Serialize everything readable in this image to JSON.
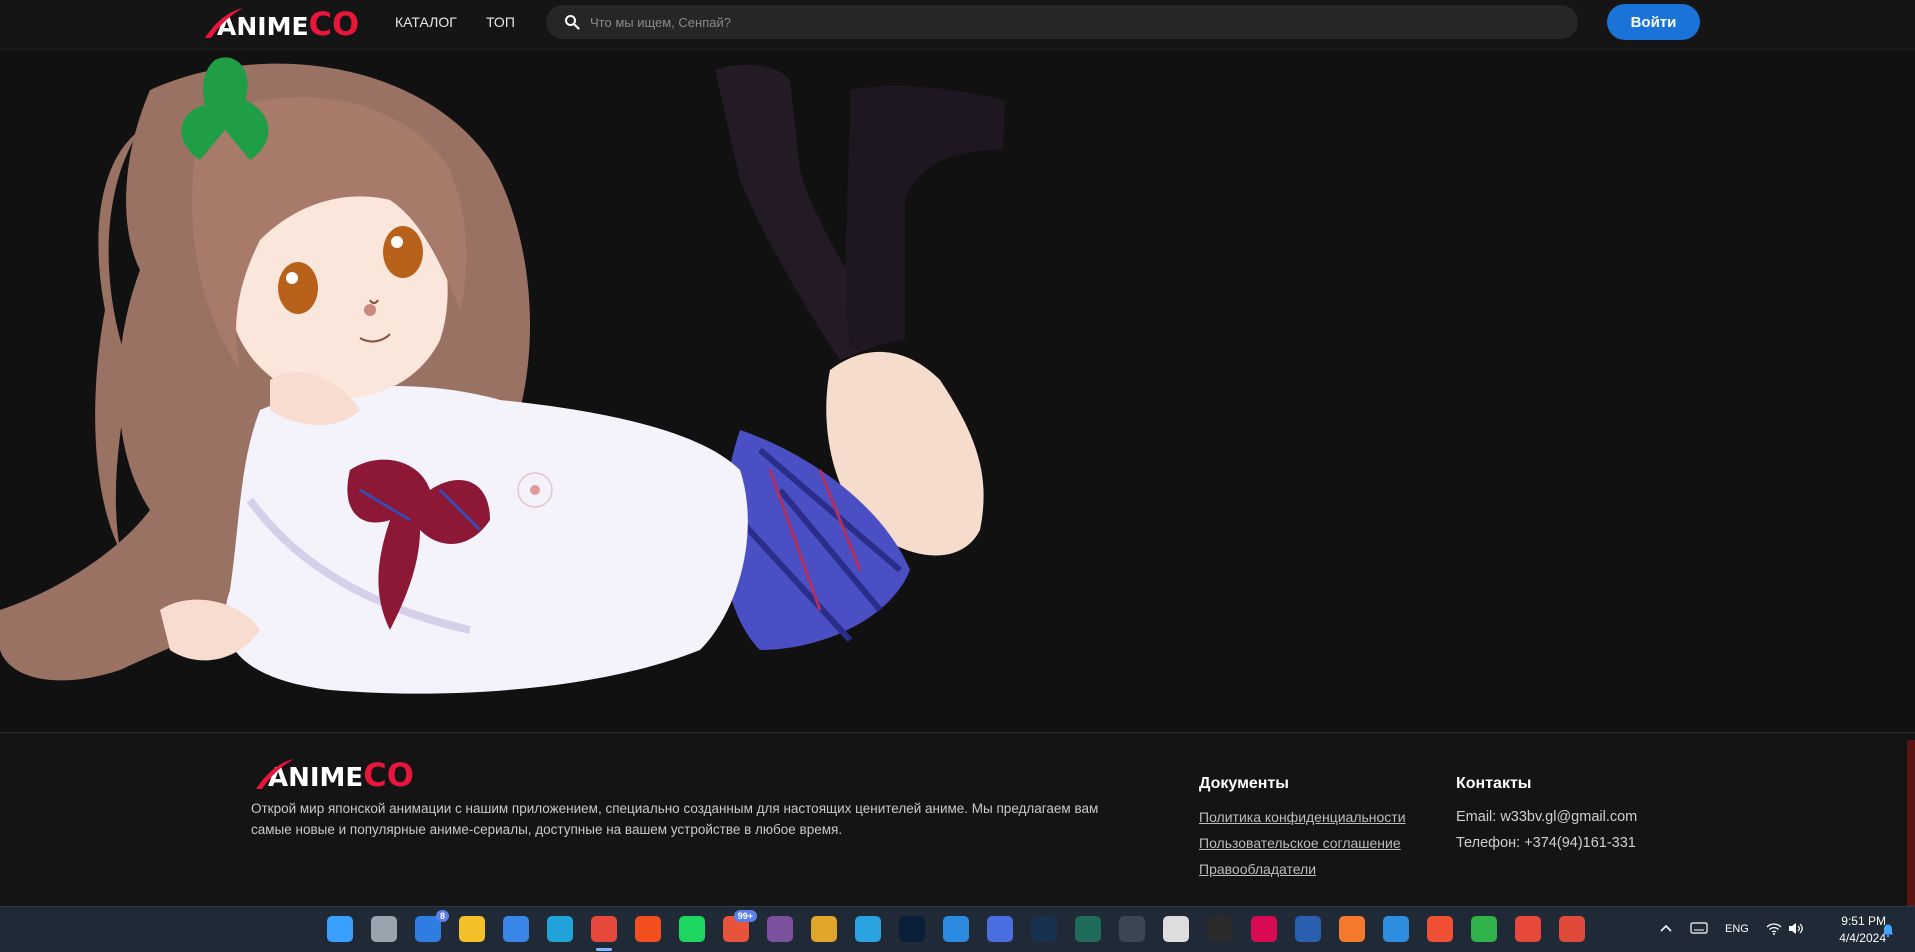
{
  "header": {
    "logo_main": "ANIME",
    "logo_accent": "CO",
    "nav": [
      {
        "label": "КАТАЛОГ"
      },
      {
        "label": "ТОП"
      }
    ],
    "search": {
      "placeholder": "Что мы ищем, Сенпай?"
    },
    "login_label": "Войти"
  },
  "footer": {
    "logo_main": "ANIME",
    "logo_accent": "CO",
    "description": "Открой мир японской анимации с нашим приложением, специально созданным для настоящих ценителей аниме. Мы предлагаем вам самые новые и популярные аниме-сериалы, доступные на вашем устройстве в любое время.",
    "documents": {
      "title": "Документы",
      "links": [
        "Политика конфиденциальности",
        "Пользовательское соглашение",
        "Правообладатели"
      ]
    },
    "contacts": {
      "title": "Контакты",
      "email": "Email: w33bv.gl@gmail.com",
      "phone": "Телефон: +374(94)161-331"
    }
  },
  "taskbar": {
    "apps": [
      {
        "name": "windows-start",
        "color": "#3aa0ff"
      },
      {
        "name": "task-view",
        "color": "#9aa4ae"
      },
      {
        "name": "widgets",
        "color": "#2f7de1",
        "badge": "8"
      },
      {
        "name": "file-explorer",
        "color": "#f3c02a"
      },
      {
        "name": "microsoft-store",
        "color": "#3a86e8"
      },
      {
        "name": "edge",
        "color": "#1fa3d8"
      },
      {
        "name": "chrome",
        "color": "#e6483b"
      },
      {
        "name": "figma",
        "color": "#f24e1e"
      },
      {
        "name": "spotify",
        "color": "#1ed760"
      },
      {
        "name": "mail",
        "color": "#e8533b",
        "badge": "99+"
      },
      {
        "name": "viber",
        "color": "#7b519d"
      },
      {
        "name": "lgbt-app",
        "color": "#e0a52a"
      },
      {
        "name": "telegram",
        "color": "#2aa3e0"
      },
      {
        "name": "photoshop",
        "color": "#0b1e3a"
      },
      {
        "name": "vscode",
        "color": "#2a8be0"
      },
      {
        "name": "app-a",
        "color": "#4a6ee0"
      },
      {
        "name": "steam",
        "color": "#17314f"
      },
      {
        "name": "terminal-green",
        "color": "#1e6b5a"
      },
      {
        "name": "calculator",
        "color": "#3a4652"
      },
      {
        "name": "unity",
        "color": "#ddd"
      },
      {
        "name": "terminal",
        "color": "#2b2b2b"
      },
      {
        "name": "debian",
        "color": "#d70a53"
      },
      {
        "name": "powershell",
        "color": "#2a5fb0"
      },
      {
        "name": "blender",
        "color": "#f5792a"
      },
      {
        "name": "remote-desktop",
        "color": "#2d8ee0"
      },
      {
        "name": "git",
        "color": "#f05033"
      },
      {
        "name": "android-app",
        "color": "#2fb34a"
      },
      {
        "name": "chrome-2",
        "color": "#e6483b"
      },
      {
        "name": "snipping-tool",
        "color": "#e04a3a"
      }
    ],
    "tray": {
      "lang": "ENG",
      "time": "9:51 PM",
      "date": "4/4/2024"
    }
  }
}
